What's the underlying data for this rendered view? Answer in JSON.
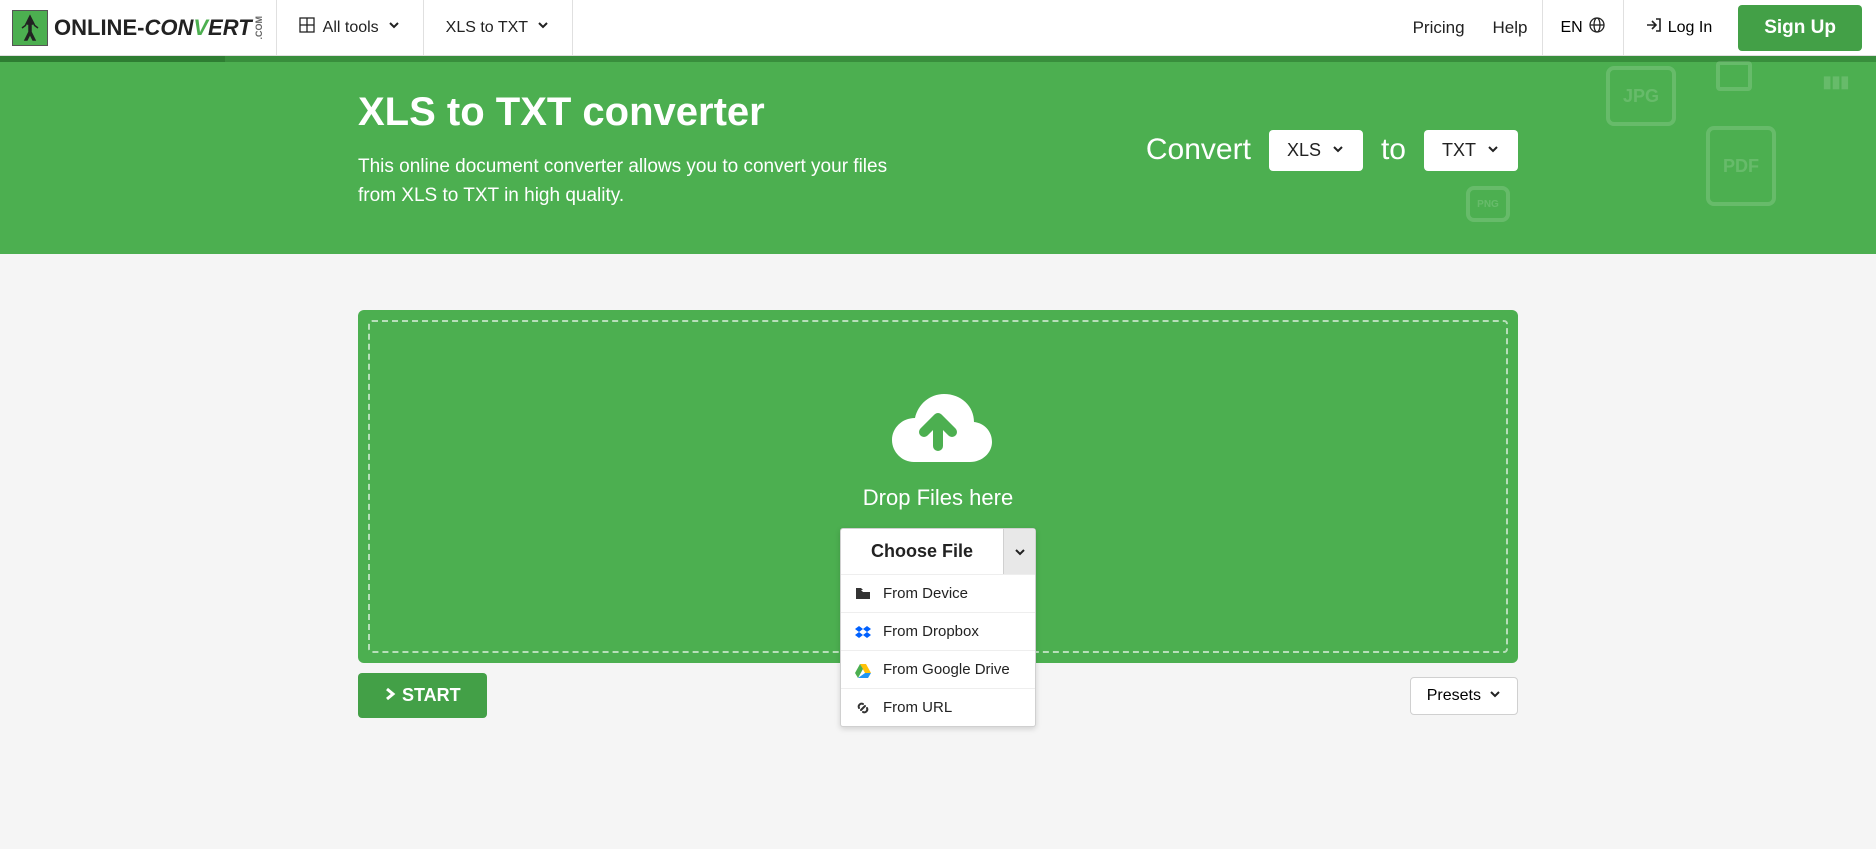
{
  "header": {
    "logo_online": "ONLINE-",
    "logo_con": "CON",
    "logo_v": "V",
    "logo_ert": "ERT",
    "logo_com": ".COM",
    "all_tools": "All tools",
    "converter_nav": "XLS to TXT",
    "pricing": "Pricing",
    "help": "Help",
    "lang": "EN",
    "login": "Log In",
    "signup": "Sign Up"
  },
  "hero": {
    "title": "XLS to TXT converter",
    "desc": "This online document converter allows you to convert your files from XLS to TXT in high quality.",
    "convert_label": "Convert",
    "from": "XLS",
    "to_label": "to",
    "to": "TXT"
  },
  "dropzone": {
    "drop_text": "Drop Files here",
    "choose_file": "Choose File",
    "menu": {
      "device": "From Device",
      "dropbox": "From Dropbox",
      "gdrive": "From Google Drive",
      "url": "From URL"
    }
  },
  "actions": {
    "start": "START",
    "presets": "Presets"
  }
}
